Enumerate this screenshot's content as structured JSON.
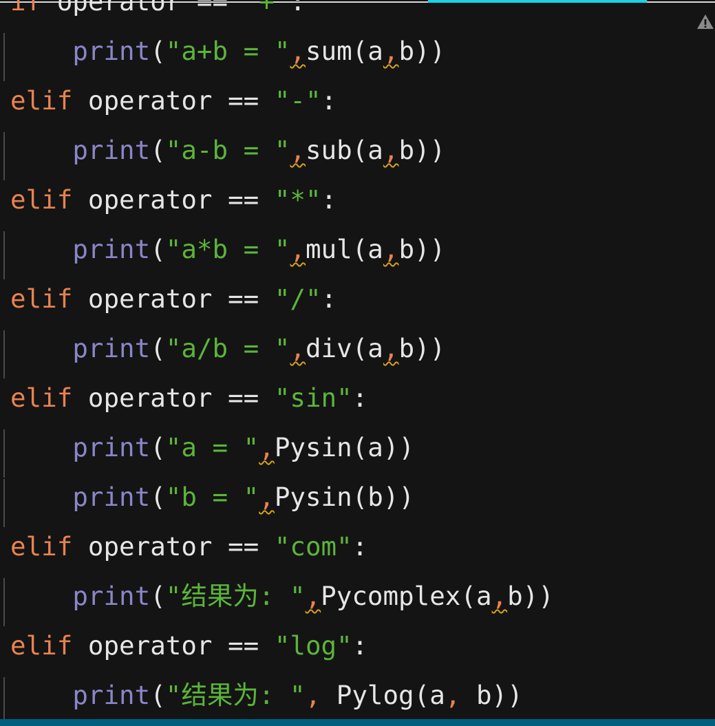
{
  "editor": {
    "lines": [
      {
        "indent": false,
        "tokens": [
          [
            "kw",
            "if "
          ],
          [
            "pl",
            "operator == "
          ],
          [
            "str",
            "\"+\""
          ],
          [
            "pl",
            ":"
          ]
        ]
      },
      {
        "indent": true,
        "tokens": [
          [
            "pl",
            "    "
          ],
          [
            "fn",
            "print"
          ],
          [
            "pl",
            "("
          ],
          [
            "str",
            "\"a+b = \""
          ],
          [
            "sq",
            ","
          ],
          [
            "pl",
            "sum(a"
          ],
          [
            "sq",
            ","
          ],
          [
            "pl",
            "b))"
          ]
        ]
      },
      {
        "indent": false,
        "tokens": [
          [
            "kw",
            "elif "
          ],
          [
            "pl",
            "operator == "
          ],
          [
            "str",
            "\"-\""
          ],
          [
            "pl",
            ":"
          ]
        ]
      },
      {
        "indent": true,
        "tokens": [
          [
            "pl",
            "    "
          ],
          [
            "fn",
            "print"
          ],
          [
            "pl",
            "("
          ],
          [
            "str",
            "\"a-b = \""
          ],
          [
            "sq",
            ","
          ],
          [
            "pl",
            "sub(a"
          ],
          [
            "sq",
            ","
          ],
          [
            "pl",
            "b))"
          ]
        ]
      },
      {
        "indent": false,
        "tokens": [
          [
            "kw",
            "elif "
          ],
          [
            "pl",
            "operator == "
          ],
          [
            "str",
            "\"*\""
          ],
          [
            "pl",
            ":"
          ]
        ]
      },
      {
        "indent": true,
        "tokens": [
          [
            "pl",
            "    "
          ],
          [
            "fn",
            "print"
          ],
          [
            "pl",
            "("
          ],
          [
            "str",
            "\"a*b = \""
          ],
          [
            "sq",
            ","
          ],
          [
            "pl",
            "mul(a"
          ],
          [
            "sq",
            ","
          ],
          [
            "pl",
            "b))"
          ]
        ]
      },
      {
        "indent": false,
        "tokens": [
          [
            "kw",
            "elif "
          ],
          [
            "pl",
            "operator == "
          ],
          [
            "str",
            "\"/\""
          ],
          [
            "pl",
            ":"
          ]
        ]
      },
      {
        "indent": true,
        "tokens": [
          [
            "pl",
            "    "
          ],
          [
            "fn",
            "print"
          ],
          [
            "pl",
            "("
          ],
          [
            "str",
            "\"a/b = \""
          ],
          [
            "sq",
            ","
          ],
          [
            "pl",
            "div(a"
          ],
          [
            "sq",
            ","
          ],
          [
            "pl",
            "b))"
          ]
        ]
      },
      {
        "indent": false,
        "tokens": [
          [
            "kw",
            "elif "
          ],
          [
            "pl",
            "operator == "
          ],
          [
            "str",
            "\"sin\""
          ],
          [
            "pl",
            ":"
          ]
        ]
      },
      {
        "indent": true,
        "tokens": [
          [
            "pl",
            "    "
          ],
          [
            "fn",
            "print"
          ],
          [
            "pl",
            "("
          ],
          [
            "str",
            "\"a = \""
          ],
          [
            "sq",
            ","
          ],
          [
            "pl",
            "Pysin(a))"
          ]
        ]
      },
      {
        "indent": true,
        "tokens": [
          [
            "pl",
            "    "
          ],
          [
            "fn",
            "print"
          ],
          [
            "pl",
            "("
          ],
          [
            "str",
            "\"b = \""
          ],
          [
            "sq",
            ","
          ],
          [
            "pl",
            "Pysin(b))"
          ]
        ]
      },
      {
        "indent": false,
        "tokens": [
          [
            "kw",
            "elif "
          ],
          [
            "pl",
            "operator == "
          ],
          [
            "str",
            "\"com\""
          ],
          [
            "pl",
            ":"
          ]
        ]
      },
      {
        "indent": true,
        "tokens": [
          [
            "pl",
            "    "
          ],
          [
            "fn",
            "print"
          ],
          [
            "pl",
            "("
          ],
          [
            "str",
            "\"结果为: \""
          ],
          [
            "sq",
            ","
          ],
          [
            "pl",
            "Pycomplex(a"
          ],
          [
            "sq",
            ","
          ],
          [
            "pl",
            "b))"
          ]
        ]
      },
      {
        "indent": false,
        "tokens": [
          [
            "kw",
            "elif "
          ],
          [
            "pl",
            "operator == "
          ],
          [
            "str",
            "\"log\""
          ],
          [
            "pl",
            ":"
          ]
        ]
      },
      {
        "indent": true,
        "tokens": [
          [
            "pl",
            "    "
          ],
          [
            "fn",
            "print"
          ],
          [
            "pl",
            "("
          ],
          [
            "str",
            "\"结果为: \""
          ],
          [
            "cm",
            ","
          ],
          [
            "pl",
            " Pylog(a"
          ],
          [
            "cm",
            ","
          ],
          [
            "pl",
            " b))"
          ]
        ]
      }
    ]
  },
  "icons": {
    "warning": "warning-icon"
  }
}
